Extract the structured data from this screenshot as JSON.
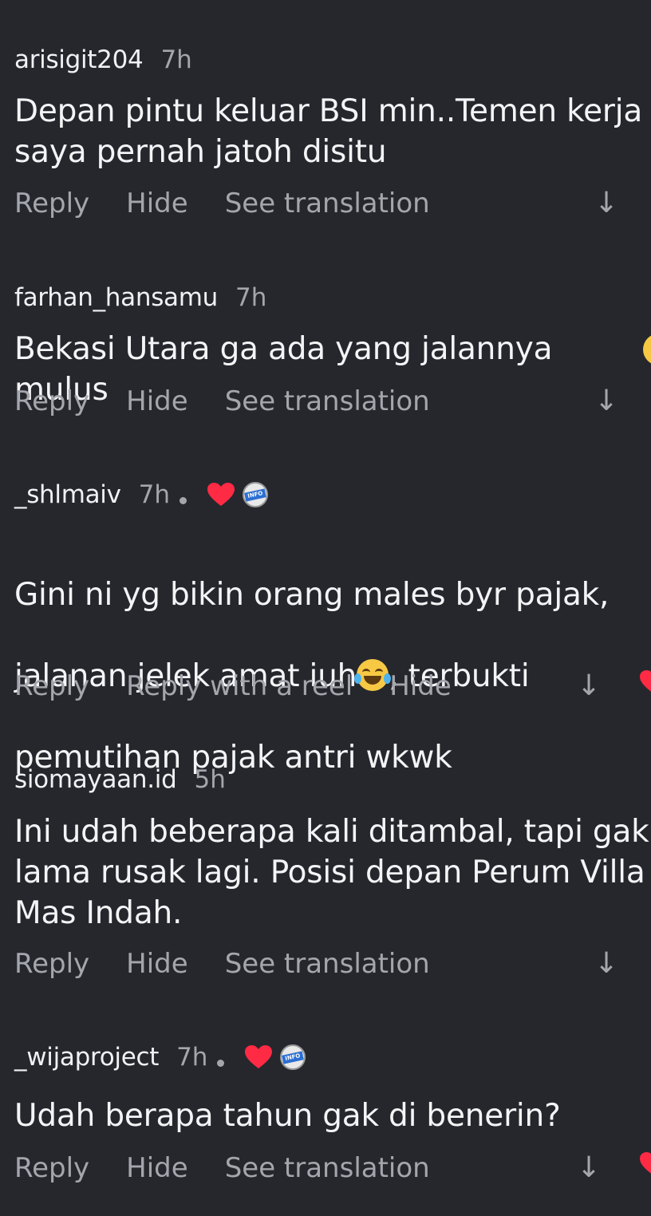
{
  "comments": [
    {
      "username": "arisigit204",
      "time": "7h",
      "text": "Depan pintu keluar BSI min..Temen kerja\nsaya pernah jatoh disitu",
      "actions": [
        "Reply",
        "Hide",
        "See translation"
      ]
    },
    {
      "username": "farhan_hansamu",
      "time": "7h",
      "text": "Bekasi Utara ga ada yang jalannya mulus",
      "actions": [
        "Reply",
        "Hide",
        "See translation"
      ]
    },
    {
      "username": "_shlmaiv",
      "time": "7h",
      "liked_by_creator": true,
      "badge_text": "INFO BEKASI UTARA",
      "text_line1": "Gini ni yg bikin orang males byr pajak,",
      "text_line2a": "jalanan jelek amat iuh",
      "text_line2b": ", terbukti",
      "text_line3": "pemutihan pajak antri wkwk",
      "actions": [
        "Reply",
        "Reply with a reel",
        "Hide"
      ]
    },
    {
      "username": "siomayaan.id",
      "time": "5h",
      "text": "Ini udah beberapa kali ditambal, tapi gak\nlama rusak lagi. Posisi depan Perum Villa\nMas Indah.",
      "actions": [
        "Reply",
        "Hide",
        "See translation"
      ]
    },
    {
      "username": "_wijaproject",
      "time": "7h",
      "liked_by_creator": true,
      "badge_text": "INFO BEKASI UTARA",
      "text": "Udah berapa tahun gak di benerin?",
      "actions": [
        "Reply",
        "Hide",
        "See translation"
      ]
    }
  ],
  "icons": {
    "view_replies": "arrow-down-icon",
    "like": "heart-icon",
    "emoji": "face-with-tears-of-joy"
  },
  "colors": {
    "background": "#25272d",
    "primary_text": "#f1f1f3",
    "secondary_text": "#a4a6ad",
    "heart": "#ff2a44"
  }
}
